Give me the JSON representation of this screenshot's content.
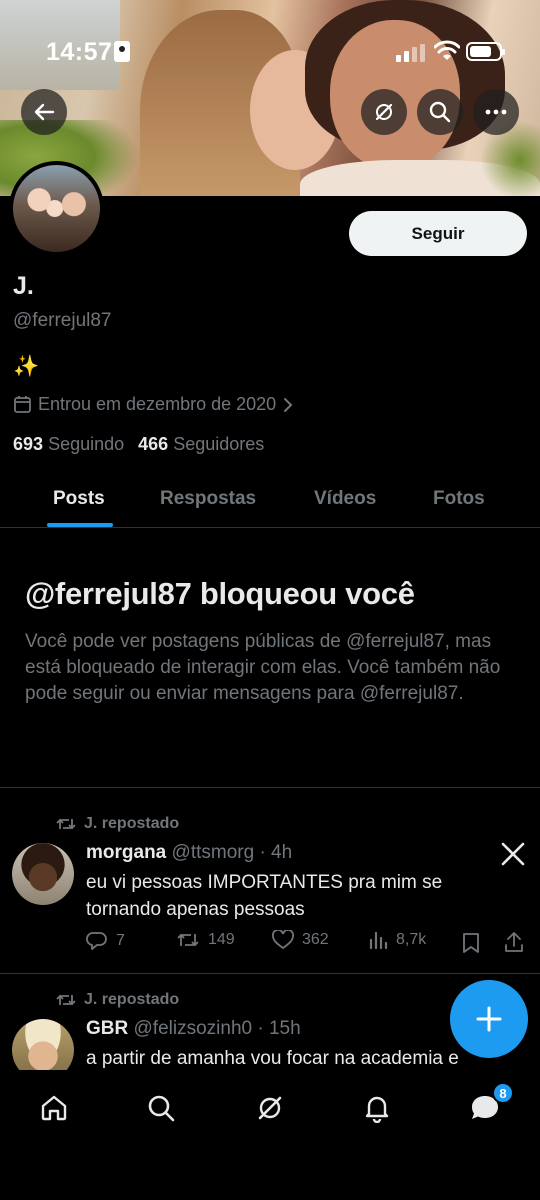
{
  "status_bar": {
    "time": "14:57",
    "battery_level": 0.75
  },
  "profile": {
    "follow_label": "Seguir",
    "name": "J.",
    "handle": "@ferrejul87",
    "bio": "✨",
    "joined": "Entrou em dezembro de 2020",
    "following_count": "693",
    "following_label": "Seguindo",
    "followers_count": "466",
    "followers_label": "Seguidores"
  },
  "tabs": [
    {
      "label": "Posts",
      "active": true
    },
    {
      "label": "Respostas",
      "active": false
    },
    {
      "label": "Vídeos",
      "active": false
    },
    {
      "label": "Fotos",
      "active": false
    }
  ],
  "blocked": {
    "title": "@ferrejul87 bloqueou você",
    "message": "Você pode ver postagens públicas de @ferrejul87, mas está bloqueado de interagir com elas. Você também não pode seguir ou enviar mensagens para @ferrejul87."
  },
  "posts": [
    {
      "repost_label": "J. repostado",
      "author_name": "morgana",
      "author_meta": "@ttsmorg · 4h",
      "text": "eu vi pessoas IMPORTANTES pra mim se tornando apenas pessoas",
      "replies": "7",
      "reposts": "149",
      "likes": "362",
      "views": "8,7k"
    },
    {
      "repost_label": "J. repostado",
      "author_name": "GBR",
      "author_meta": "@felizsozinh0 · 15h",
      "text": "a partir de amanha vou focar na academia e"
    }
  ],
  "notifications_badge": "8",
  "colors": {
    "accent": "#1d9bf0",
    "muted": "#71767b",
    "text": "#e7e9ea",
    "background": "#000000",
    "divider": "#2f3336"
  }
}
